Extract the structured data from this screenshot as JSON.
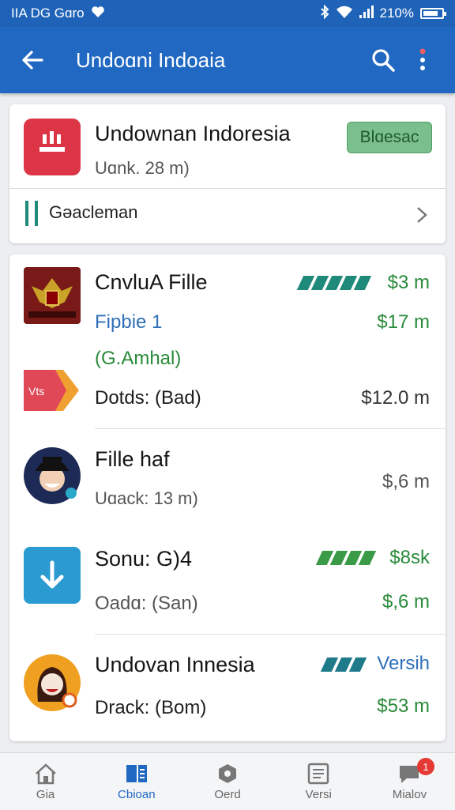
{
  "status_bar": {
    "left_text": "ΙΙΑ DG Gɑro",
    "battery": "210%"
  },
  "app_bar": {
    "title": "Undoɑni Indoaia"
  },
  "top_card": {
    "title": "Undownan Indoresia",
    "subtitle": "Uɑnk. 28 m)",
    "badge": "Blɑesac",
    "row_label": "Gǝacleman"
  },
  "list": [
    {
      "title": "CnvluA Fille",
      "line2": "Fipbie 1",
      "line3": "(G.Amhal)",
      "line4": "Dotds: (Bad)",
      "right1": "$3 m",
      "right2": "$17 m",
      "right4": "$12.0 m"
    },
    {
      "title": "Fille haf",
      "line2": "Uɑack: 13 m)",
      "right2": "$,6 m"
    },
    {
      "title": "Sonu: G)4",
      "line2": "Oadɑ: (San)",
      "right1": "$8sk",
      "right2": "$,6 m"
    },
    {
      "title": "Undovan Innesia",
      "line2": "Drack: (Bom)",
      "right1": "Versih",
      "right2": "$53 m"
    }
  ],
  "bottom_nav": [
    {
      "label": "Gia",
      "icon": "home-icon"
    },
    {
      "label": "Cbioan",
      "icon": "library-icon"
    },
    {
      "label": "Oerd",
      "icon": "badge-icon"
    },
    {
      "label": "Versi",
      "icon": "document-icon"
    },
    {
      "label": "Mialov",
      "icon": "chat-icon",
      "badge": "1"
    }
  ],
  "colors": {
    "primary": "#2068c2",
    "accent_green": "#2a8a3a",
    "accent_blue": "#2f6fb8",
    "stripe_teal": "#1f8a7a"
  }
}
